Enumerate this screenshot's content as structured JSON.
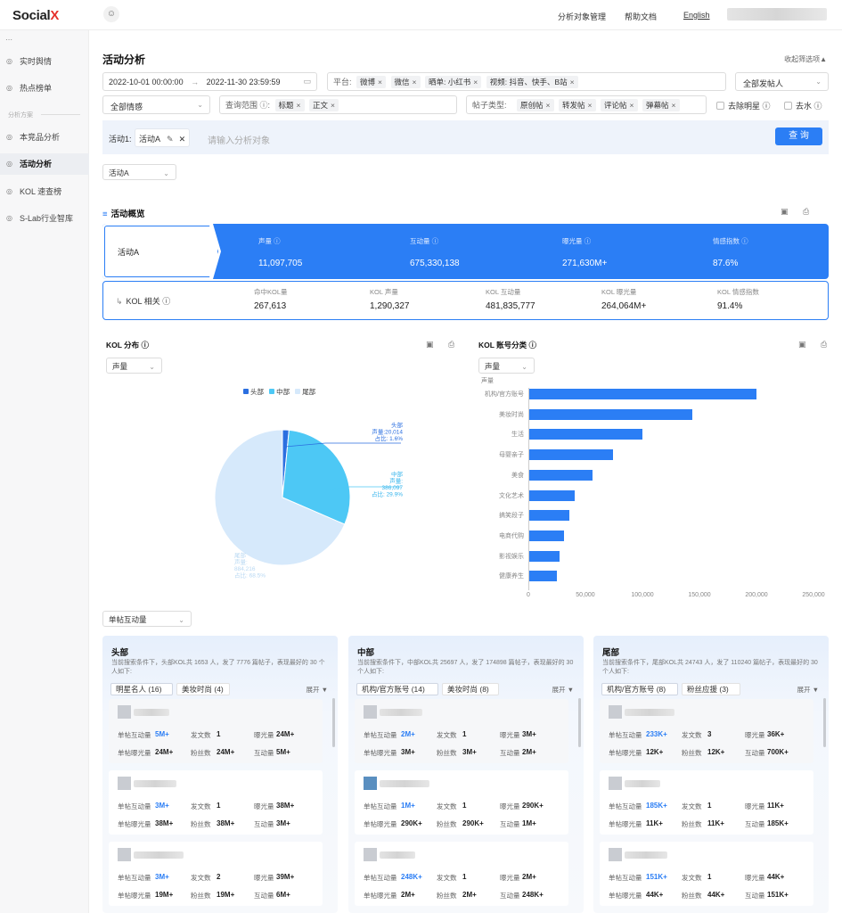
{
  "app": {
    "logo_a": "Soci",
    "logo_b": "al",
    "logo_c": "X"
  },
  "topnav": {
    "links": [
      "分析对象管理",
      "帮助文档"
    ],
    "lang": "English"
  },
  "sidebar": {
    "collapse": "⋯",
    "group_label": "分析方案",
    "items": [
      {
        "label": "实时舆情",
        "icon": "◎"
      },
      {
        "label": "热点榜单",
        "icon": "◎"
      },
      {
        "label": "本竞品分析",
        "icon": "◎"
      },
      {
        "label": "活动分析",
        "icon": "◎",
        "active": true
      },
      {
        "label": "KOL 速查榜",
        "icon": "◎"
      },
      {
        "label": "S-Lab行业智库",
        "icon": "◎"
      }
    ]
  },
  "page": {
    "title": "活动分析",
    "fold": "收起筛选项▲"
  },
  "filters": {
    "start": "2022-10-01 00:00:00",
    "arrow": "→",
    "end": "2022-11-30 23:59:59",
    "platform_label": "平台:",
    "platforms": [
      "微博",
      "微信",
      "晒单: 小红书",
      "视频: 抖音、快手、B站"
    ],
    "publisher": "全部发帖人",
    "sentiment": "全部情感",
    "scope_label": "查询范围 ⓘ:",
    "scopes": [
      "标题",
      "正文"
    ],
    "post_type_label": "帖子类型:",
    "post_types": [
      "原创帖",
      "转发帖",
      "评论帖",
      "弹幕帖"
    ],
    "remove_star": "去除明星 ⓘ",
    "remove_water": "去水 ⓘ"
  },
  "activity": {
    "label": "活动1:",
    "tag": "活动A",
    "placeholder": "请输入分析对象",
    "query": "查 询",
    "select": "活动A"
  },
  "overview": {
    "title": "活动概览",
    "name": "活动A",
    "metrics": [
      {
        "label": "声量 ⓘ",
        "value": "11,097,705"
      },
      {
        "label": "互动量 ⓘ",
        "value": "675,330,138"
      },
      {
        "label": "曝光量 ⓘ",
        "value": "271,630M+"
      },
      {
        "label": "情感指数 ⓘ",
        "value": "87.6%"
      }
    ],
    "kol_label": "KOL 相关 ⓘ",
    "kol_metrics": [
      {
        "label": "命中KOL量",
        "value": "267,613"
      },
      {
        "label": "KOL 声量",
        "value": "1,290,327"
      },
      {
        "label": "KOL 互动量",
        "value": "481,835,777"
      },
      {
        "label": "KOL 曝光量",
        "value": "264,064M+"
      },
      {
        "label": "KOL 情感指数",
        "value": "91.4%"
      }
    ]
  },
  "kol_dist": {
    "title": "KOL 分布 ⓘ",
    "select": "声量"
  },
  "kol_cat": {
    "title": "KOL 账号分类 ⓘ",
    "select": "声量",
    "axis_label": "声量"
  },
  "interaction_select": "单帖互动量",
  "chart_data": [
    {
      "type": "pie",
      "legend": [
        "头部",
        "中部",
        "尾部"
      ],
      "slices": [
        {
          "name": "头部",
          "value": 20014,
          "share": "1.6%",
          "color": "#2b6fe0"
        },
        {
          "name": "中部",
          "value": 386097,
          "share": "29.9%",
          "color": "#4dc8f5"
        },
        {
          "name": "尾部",
          "value": 884216,
          "share": "68.5%",
          "color": "#d6e9fb"
        }
      ],
      "labels": [
        [
          "头部",
          "声量:20,014",
          "占比: 1.6%"
        ],
        [
          "中部",
          "声量:",
          "386,097",
          "占比: 29.9%"
        ],
        [
          "尾部",
          "声量:",
          "884,216",
          "占比: 68.5%"
        ]
      ]
    },
    {
      "type": "bar",
      "orientation": "horizontal",
      "ylabel": "声量",
      "categories": [
        "机构/官方账号",
        "美妆时尚",
        "生活",
        "母婴亲子",
        "美食",
        "文化艺术",
        "搞笑段子",
        "电商代购",
        "影视娱乐",
        "健康养生"
      ],
      "values": [
        200000,
        144000,
        100000,
        74000,
        56000,
        41000,
        36000,
        31000,
        27000,
        25000
      ],
      "xticks": [
        "0",
        "50,000",
        "100,000",
        "150,000",
        "200,000",
        "250,000"
      ],
      "xlim": [
        0,
        250000
      ]
    }
  ],
  "tiers": [
    {
      "title": "头部",
      "desc": "当前搜索条件下，头部KOL共 1653 人，发了 7776 篇帖子，表现最好的 30 个人如下:",
      "tags": [
        "明星名人 (16)",
        "美妆时尚 (4)"
      ],
      "expand": "展开 ▼",
      "items": [
        [
          "5M+",
          "1",
          "24M+",
          "24M+",
          "24M+",
          "5M+"
        ],
        [
          "3M+",
          "1",
          "38M+",
          "38M+",
          "38M+",
          "3M+"
        ],
        [
          "3M+",
          "2",
          "39M+",
          "19M+",
          "19M+",
          "6M+"
        ]
      ]
    },
    {
      "title": "中部",
      "desc": "当前搜索条件下，中部KOL共 25697 人，发了 174898 篇帖子，表现最好的 30 个人如下:",
      "tags": [
        "机构/官方账号 (14)",
        "美妆时尚 (8)"
      ],
      "expand": "展开 ▼",
      "items": [
        [
          "2M+",
          "1",
          "3M+",
          "3M+",
          "3M+",
          "2M+"
        ],
        [
          "1M+",
          "1",
          "290K+",
          "290K+",
          "290K+",
          "1M+"
        ],
        [
          "248K+",
          "1",
          "2M+",
          "2M+",
          "2M+",
          "248K+"
        ]
      ]
    },
    {
      "title": "尾部",
      "desc": "当前搜索条件下，尾部KOL共 24743 人，发了 110240 篇帖子，表现最好的 30 个人如下:",
      "tags": [
        "机构/官方账号 (8)",
        "粉丝应援 (3)"
      ],
      "expand": "展开 ▼",
      "items": [
        [
          "233K+",
          "3",
          "36K+",
          "12K+",
          "12K+",
          "700K+"
        ],
        [
          "185K+",
          "1",
          "11K+",
          "11K+",
          "11K+",
          "185K+"
        ],
        [
          "151K+",
          "1",
          "44K+",
          "44K+",
          "44K+",
          "151K+"
        ]
      ]
    }
  ],
  "metric_labels": {
    "a": "单帖互动量",
    "b": "发文数",
    "c": "曝光量",
    "d": "单帖曝光量",
    "e": "粉丝数",
    "f": "互动量"
  }
}
